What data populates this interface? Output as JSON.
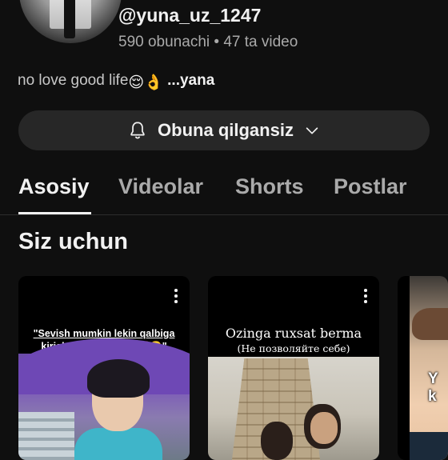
{
  "channel": {
    "handle": "@yuna_uz_1247",
    "subscribers": "590 obunachi",
    "separator": "•",
    "video_count": "47 ta video",
    "bio_text": "no love good life",
    "bio_emojis": "😌👌",
    "bio_more": "...yana"
  },
  "subscribe": {
    "label": "Obuna qilgansiz",
    "bell_icon": "bell-icon",
    "chevron_icon": "chevron-down-icon"
  },
  "tabs": [
    {
      "label": "Asosiy",
      "active": true
    },
    {
      "label": "Videolar",
      "active": false
    },
    {
      "label": "Shorts",
      "active": false
    },
    {
      "label": "Postlar",
      "active": false
    }
  ],
  "section": {
    "title": "Siz uchun"
  },
  "cards": [
    {
      "caption_line1": "\"Sevish mumkin lekin qalbiga",
      "caption_line2": "kirish mumkin emas❤️‍🩹🥲\""
    },
    {
      "title": "Ozinga ruxsat berma",
      "subtitle": "(Не позволяйте себе)"
    },
    {
      "overlay_line1": "Y",
      "overlay_line2": "k"
    }
  ],
  "colors": {
    "background": "#0f0f0f",
    "button_bg": "#272727",
    "text_primary": "#f1f1f1",
    "text_secondary": "#aaaaaa"
  }
}
